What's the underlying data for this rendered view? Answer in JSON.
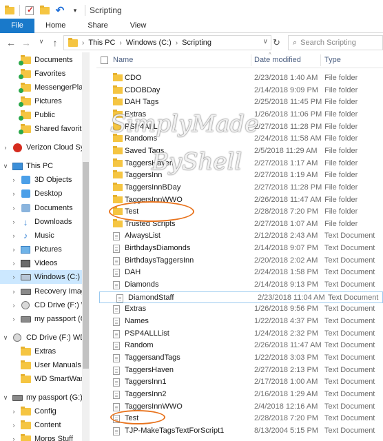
{
  "window": {
    "title": "Scripting"
  },
  "colors": {
    "accent": "#1979ca",
    "folder": "#f5c542",
    "selection": "#cce8ff",
    "annotation": "#e8741f"
  },
  "ribbon": {
    "tabs": [
      "File",
      "Home",
      "Share",
      "View"
    ]
  },
  "address": {
    "crumbs": [
      "This PC",
      "Windows (C:)",
      "Scripting"
    ],
    "search_placeholder": "Search Scripting"
  },
  "nav": {
    "items": [
      {
        "label": "Documents",
        "icon": "folder-synced-icon"
      },
      {
        "label": "Favorites",
        "icon": "folder-synced-icon"
      },
      {
        "label": "MessengerPlay",
        "icon": "folder-synced-icon"
      },
      {
        "label": "Pictures",
        "icon": "folder-synced-icon"
      },
      {
        "label": "Public",
        "icon": "folder-synced-icon"
      },
      {
        "label": "Shared favorites",
        "icon": "folder-synced-icon"
      },
      {
        "label": "Verizon Cloud Syn",
        "icon": "verizon-icon"
      },
      {
        "label": "This PC",
        "icon": "computer-icon"
      },
      {
        "label": "3D Objects",
        "icon": "3d-objects-icon"
      },
      {
        "label": "Desktop",
        "icon": "desktop-icon"
      },
      {
        "label": "Documents",
        "icon": "documents-icon"
      },
      {
        "label": "Downloads",
        "icon": "downloads-icon"
      },
      {
        "label": "Music",
        "icon": "music-icon"
      },
      {
        "label": "Pictures",
        "icon": "pictures-icon"
      },
      {
        "label": "Videos",
        "icon": "videos-icon"
      },
      {
        "label": "Windows (C:)",
        "icon": "drive-icon"
      },
      {
        "label": "Recovery Image",
        "icon": "drive-icon"
      },
      {
        "label": "CD Drive (F:) WD",
        "icon": "cd-drive-icon"
      },
      {
        "label": "my passport (G:)",
        "icon": "drive-icon"
      },
      {
        "label": "CD Drive (F:) WD S",
        "icon": "cd-drive-icon"
      },
      {
        "label": "Extras",
        "icon": "folder-icon"
      },
      {
        "label": "User Manuals",
        "icon": "folder-icon"
      },
      {
        "label": "WD SmartWare",
        "icon": "folder-icon"
      },
      {
        "label": "my passport (G:)",
        "icon": "drive-icon"
      },
      {
        "label": "Config",
        "icon": "folder-icon"
      },
      {
        "label": "Content",
        "icon": "folder-icon"
      },
      {
        "label": "Morps Stuff",
        "icon": "folder-icon"
      }
    ]
  },
  "columns": {
    "name": "Name",
    "date": "Date modified",
    "type": "Type"
  },
  "files": [
    {
      "name": "CDO",
      "date": "2/23/2018 1:40 AM",
      "type": "File folder",
      "kind": "folder"
    },
    {
      "name": "CDOBDay",
      "date": "2/14/2018 9:09 PM",
      "type": "File folder",
      "kind": "folder"
    },
    {
      "name": "DAH Tags",
      "date": "2/25/2018 11:45 PM",
      "type": "File folder",
      "kind": "folder"
    },
    {
      "name": "Extras",
      "date": "1/26/2018 11:06 PM",
      "type": "File folder",
      "kind": "folder"
    },
    {
      "name": "PSP4ALL",
      "date": "2/27/2018 11:28 PM",
      "type": "File folder",
      "kind": "folder"
    },
    {
      "name": "Randoms",
      "date": "2/24/2018 11:58 AM",
      "type": "File folder",
      "kind": "folder"
    },
    {
      "name": "Saved Tags",
      "date": "2/5/2018 11:29 AM",
      "type": "File folder",
      "kind": "folder"
    },
    {
      "name": "TaggersHaven",
      "date": "2/27/2018 1:17 AM",
      "type": "File folder",
      "kind": "folder"
    },
    {
      "name": "TaggersInn",
      "date": "2/27/2018 1:19 AM",
      "type": "File folder",
      "kind": "folder"
    },
    {
      "name": "TaggersInnBDay",
      "date": "2/27/2018 11:28 PM",
      "type": "File folder",
      "kind": "folder"
    },
    {
      "name": "TaggersInnWWO",
      "date": "2/26/2018 11:47 AM",
      "type": "File folder",
      "kind": "folder"
    },
    {
      "name": "Test",
      "date": "2/28/2018 7:20 PM",
      "type": "File folder",
      "kind": "folder"
    },
    {
      "name": "Trusted Scripts",
      "date": "2/27/2018 1:07 AM",
      "type": "File folder",
      "kind": "folder"
    },
    {
      "name": "AlwaysList",
      "date": "2/12/2018 2:43 AM",
      "type": "Text Document",
      "kind": "doc"
    },
    {
      "name": "BirthdaysDiamonds",
      "date": "2/14/2018 9:07 PM",
      "type": "Text Document",
      "kind": "doc"
    },
    {
      "name": "BirthdaysTaggersInn",
      "date": "2/20/2018 2:02 AM",
      "type": "Text Document",
      "kind": "doc"
    },
    {
      "name": "DAH",
      "date": "2/24/2018 1:58 PM",
      "type": "Text Document",
      "kind": "doc"
    },
    {
      "name": "Diamonds",
      "date": "2/14/2018 9:13 PM",
      "type": "Text Document",
      "kind": "doc"
    },
    {
      "name": "DiamondStaff",
      "date": "2/23/2018 11:04 AM",
      "type": "Text Document",
      "kind": "doc"
    },
    {
      "name": "Extras",
      "date": "1/26/2018 9:56 PM",
      "type": "Text Document",
      "kind": "doc"
    },
    {
      "name": "Names",
      "date": "1/22/2018 4:37 PM",
      "type": "Text Document",
      "kind": "doc"
    },
    {
      "name": "PSP4ALLList",
      "date": "1/24/2018 2:32 PM",
      "type": "Text Document",
      "kind": "doc"
    },
    {
      "name": "Random",
      "date": "2/26/2018 11:47 AM",
      "type": "Text Document",
      "kind": "doc"
    },
    {
      "name": "TaggersandTags",
      "date": "1/22/2018 3:03 PM",
      "type": "Text Document",
      "kind": "doc"
    },
    {
      "name": "TaggersHaven",
      "date": "2/27/2018 2:13 PM",
      "type": "Text Document",
      "kind": "doc"
    },
    {
      "name": "TaggersInn1",
      "date": "2/17/2018 1:00 AM",
      "type": "Text Document",
      "kind": "doc"
    },
    {
      "name": "TaggersInn2",
      "date": "2/16/2018 1:29 AM",
      "type": "Text Document",
      "kind": "doc"
    },
    {
      "name": "TaggersInnWWO",
      "date": "2/4/2018 12:16 AM",
      "type": "Text Document",
      "kind": "doc"
    },
    {
      "name": "Test",
      "date": "2/28/2018 7:20 PM",
      "type": "Text Document",
      "kind": "doc"
    },
    {
      "name": "TJP-MakeTagsTextForScript1",
      "date": "8/13/2004 5:15 PM",
      "type": "Text Document",
      "kind": "doc"
    }
  ],
  "watermark": {
    "line1": "SimplyMade",
    "line2": "ByShell"
  }
}
